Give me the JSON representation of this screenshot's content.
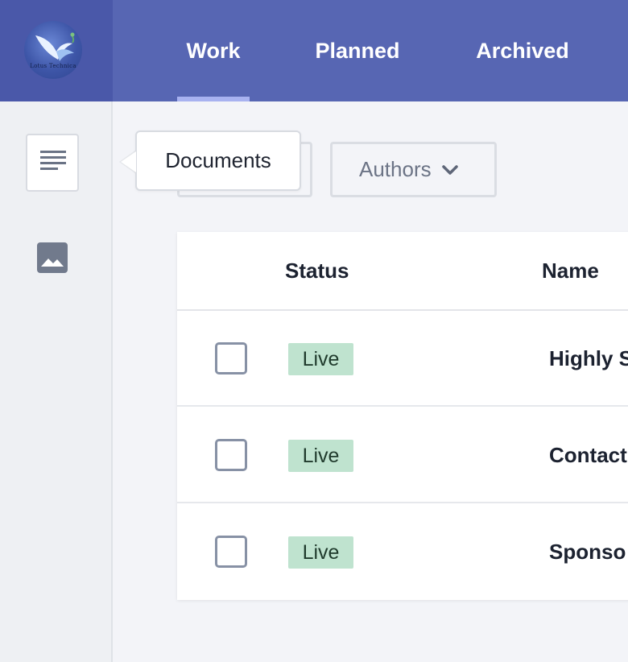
{
  "header": {
    "logo_text": "Lotus Technica",
    "tabs": [
      {
        "label": "Work",
        "active": true
      },
      {
        "label": "Planned",
        "active": false
      },
      {
        "label": "Archived",
        "active": false
      }
    ]
  },
  "sidebar": {
    "items": [
      {
        "icon": "documents-icon",
        "tooltip": "Documents",
        "active": true
      },
      {
        "icon": "image-icon",
        "active": false
      }
    ]
  },
  "filters": {
    "authors_label": "Authors"
  },
  "table": {
    "columns": [
      "Status",
      "Name"
    ],
    "rows": [
      {
        "status": "Live",
        "name": "Highly S"
      },
      {
        "status": "Live",
        "name": "Contact"
      },
      {
        "status": "Live",
        "name": "Sponso"
      }
    ]
  },
  "colors": {
    "header_bg": "#5766b3",
    "logo_bg": "#4a58a9",
    "active_underline": "#a8b2f0",
    "status_live": "#bfe3cf"
  }
}
